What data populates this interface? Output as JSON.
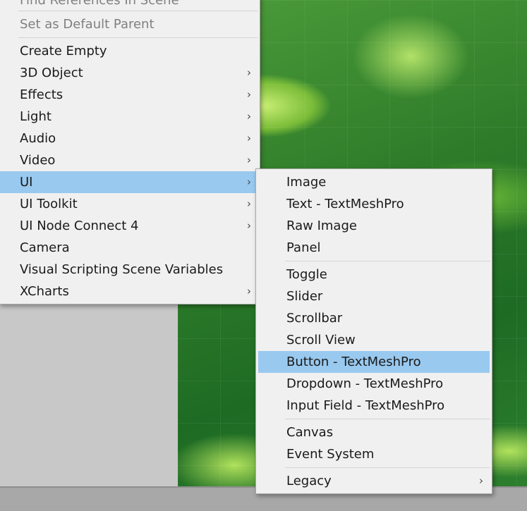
{
  "main_menu": {
    "items": [
      {
        "label": "Find References In Scene",
        "disabled": true,
        "submenu": false
      },
      {
        "label": "Set as Default Parent",
        "disabled": true,
        "submenu": false
      },
      {
        "label": "Create Empty",
        "submenu": false
      },
      {
        "label": "3D Object",
        "submenu": true
      },
      {
        "label": "Effects",
        "submenu": true
      },
      {
        "label": "Light",
        "submenu": true
      },
      {
        "label": "Audio",
        "submenu": true
      },
      {
        "label": "Video",
        "submenu": true
      },
      {
        "label": "UI",
        "submenu": true,
        "highlighted": true
      },
      {
        "label": "UI Toolkit",
        "submenu": true
      },
      {
        "label": "UI Node Connect 4",
        "submenu": true
      },
      {
        "label": "Camera",
        "submenu": false
      },
      {
        "label": "Visual Scripting Scene Variables",
        "submenu": false
      },
      {
        "label": "XCharts",
        "submenu": true
      }
    ]
  },
  "sub_menu": {
    "items": [
      {
        "label": "Image"
      },
      {
        "label": "Text - TextMeshPro"
      },
      {
        "label": "Raw Image"
      },
      {
        "label": "Panel"
      },
      {
        "label": "Toggle"
      },
      {
        "label": "Slider"
      },
      {
        "label": "Scrollbar"
      },
      {
        "label": "Scroll View"
      },
      {
        "label": "Button - TextMeshPro",
        "highlighted": true
      },
      {
        "label": "Dropdown - TextMeshPro"
      },
      {
        "label": "Input Field - TextMeshPro"
      },
      {
        "label": "Canvas"
      },
      {
        "label": "Event System"
      },
      {
        "label": "Legacy",
        "submenu": true
      }
    ]
  },
  "icons": {
    "submenu_arrow": "chevron-right-icon"
  },
  "colors": {
    "highlight": "#99c9ef",
    "menu_bg": "#f0f0f0"
  }
}
